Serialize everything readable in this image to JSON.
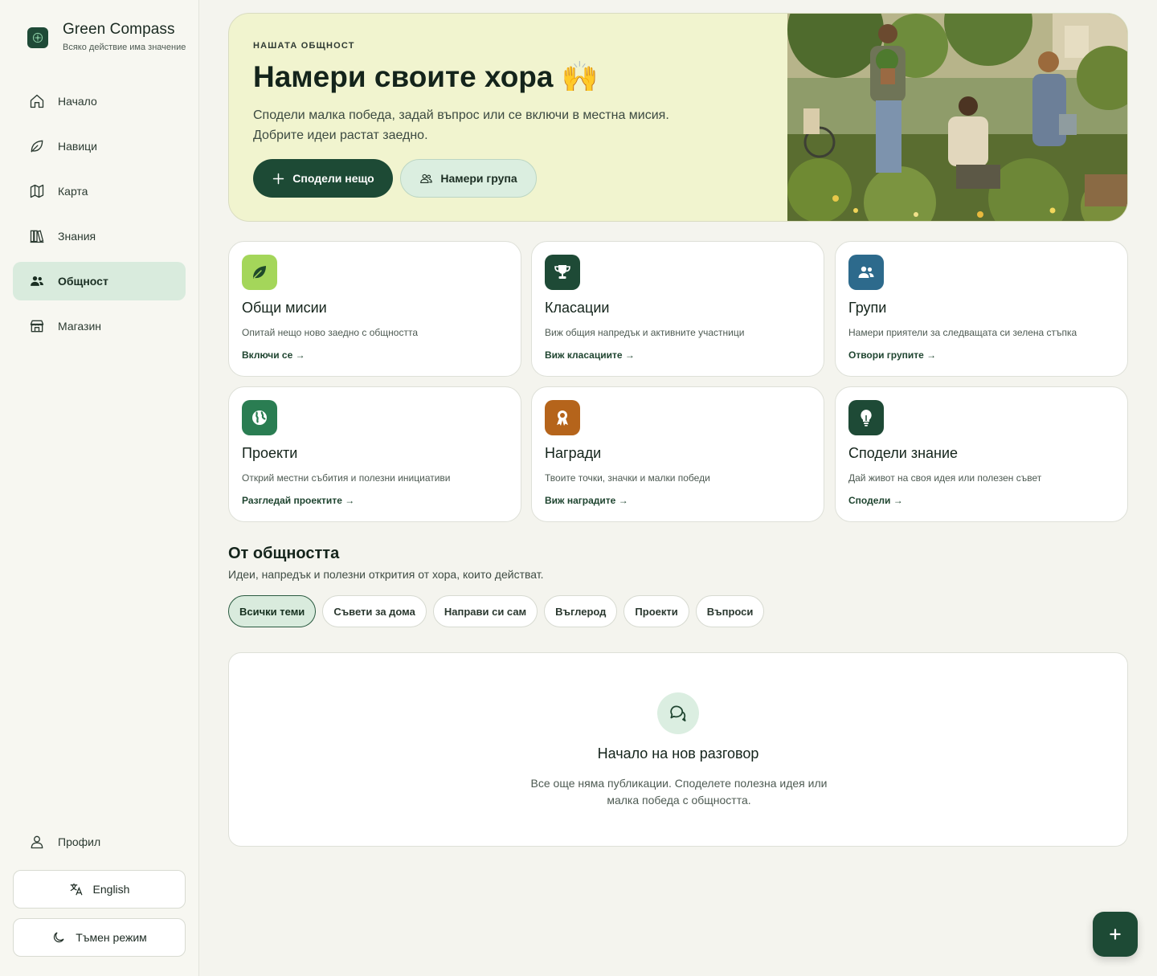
{
  "brand": {
    "title": "Green Compass",
    "subtitle": "Всяко действие има значение"
  },
  "nav": {
    "items": [
      {
        "label": "Начало",
        "icon": "home-icon"
      },
      {
        "label": "Навици",
        "icon": "leaf-icon"
      },
      {
        "label": "Карта",
        "icon": "map-icon"
      },
      {
        "label": "Знания",
        "icon": "books-icon"
      },
      {
        "label": "Общност",
        "icon": "people-icon",
        "active": true
      },
      {
        "label": "Магазин",
        "icon": "store-icon"
      }
    ],
    "profile": "Профил",
    "language": "English",
    "theme": "Тъмен режим"
  },
  "hero": {
    "eyebrow": "НАШАТА ОБЩНОСТ",
    "title": "Намери своите хора 🙌",
    "description": "Сподели малка победа, задай въпрос или се включи в местна мисия. Добрите идеи растат заедно.",
    "primary_button": "Сподели нещо",
    "secondary_button": "Намери група"
  },
  "cards": [
    {
      "title": "Общи мисии",
      "desc": "Опитай нещо ново заедно с общността",
      "link": "Включи се →",
      "icon": "leaf-icon",
      "color": "#9fd24f"
    },
    {
      "title": "Класации",
      "desc": "Виж общия напредък и активните участници",
      "link": "Виж класациите →",
      "icon": "trophy-icon",
      "color": "#1e4a36"
    },
    {
      "title": "Групи",
      "desc": "Намери приятели за следващата си зелена стъпка",
      "link": "Отвори групите →",
      "icon": "group-icon",
      "color": "#2d6a8c"
    },
    {
      "title": "Проекти",
      "desc": "Открий местни събития и полезни инициативи",
      "link": "Разгледай проектите →",
      "icon": "globe-icon",
      "color": "#2a7d52"
    },
    {
      "title": "Награди",
      "desc": "Твоите точки, значки и малки победи",
      "link": "Виж наградите →",
      "icon": "award-icon",
      "color": "#b5641b"
    },
    {
      "title": "Сподели знание",
      "desc": "Дай живот на своя идея или полезен съвет",
      "link": "Сподели →",
      "icon": "lightbulb-icon",
      "color": "#1e4a36"
    }
  ],
  "section": {
    "title": "От общността",
    "subtitle": "Идеи, напредък и полезни открития от хора, които действат.",
    "chips": [
      "Всички теми",
      "Съвети за дома",
      "Направи си сам",
      "Въглерод",
      "Проекти",
      "Въпроси"
    ]
  },
  "empty": {
    "title": "Начало на нов разговор",
    "description": "Все още няма публикации. Споделете полезна идея или малка победа с общността."
  }
}
